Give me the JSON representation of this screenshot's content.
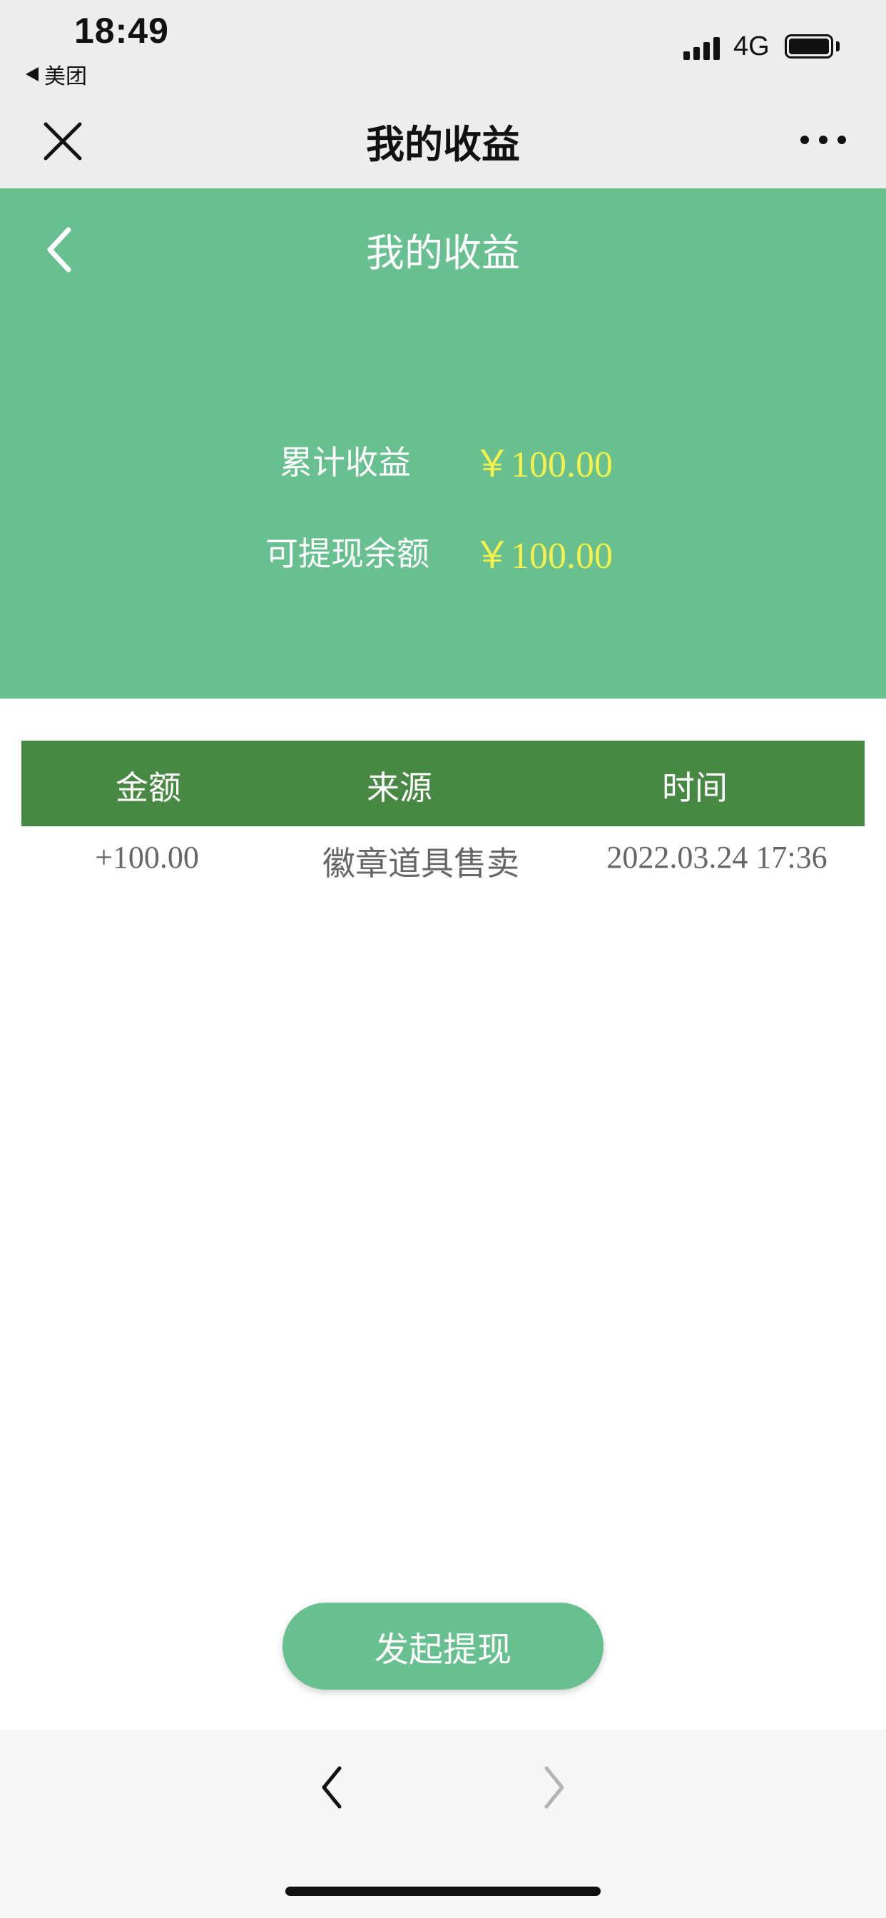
{
  "status_bar": {
    "time": "18:49",
    "back_app": "美团",
    "network": "4G"
  },
  "nav": {
    "title": "我的收益",
    "close_icon": "close-icon",
    "more_icon": "more-icon"
  },
  "header": {
    "title": "我的收益",
    "total_label": "累计收益",
    "total_value": "￥100.00",
    "withdrawable_label": "可提现余额",
    "withdrawable_value": "￥100.00",
    "bg_color": "#68bf8f",
    "value_color": "#f4f14a"
  },
  "table": {
    "columns": [
      "金额",
      "来源",
      "时间"
    ],
    "rows": [
      {
        "amount": "+100.00",
        "source": "徽章道具售卖",
        "time": "2022.03.24 17:36"
      }
    ],
    "header_color": "#478943"
  },
  "withdraw_button": {
    "label": "发起提现"
  },
  "browser_bar": {
    "back_icon": "chevron-left-icon",
    "forward_icon": "chevron-right-icon"
  }
}
